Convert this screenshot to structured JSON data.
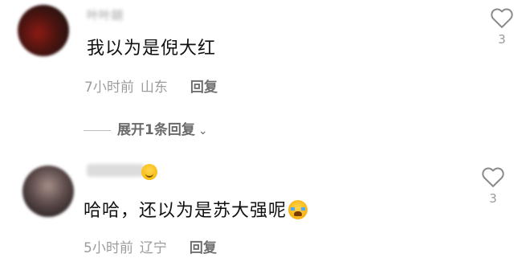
{
  "comments": [
    {
      "username": "叶叶胡",
      "text": "我以为是倪大红",
      "time": "7小时前",
      "location": "山东",
      "reply_label": "回复",
      "likes": "3"
    },
    {
      "username": "",
      "text": "哈哈，还以为是苏大强呢",
      "time": "5小时前",
      "location": "辽宁",
      "reply_label": "回复",
      "likes": "3"
    }
  ],
  "expand_replies": {
    "label": "展开1条回复",
    "icon": "chevron-down-icon"
  },
  "icons": {
    "like": "heart-outline-icon",
    "emoji_smile": "smile-emoji-icon",
    "emoji_cry": "cry-emoji-icon"
  },
  "colors": {
    "text": "#111111",
    "meta": "#9c9c9c",
    "reply": "#6f6f6f"
  }
}
